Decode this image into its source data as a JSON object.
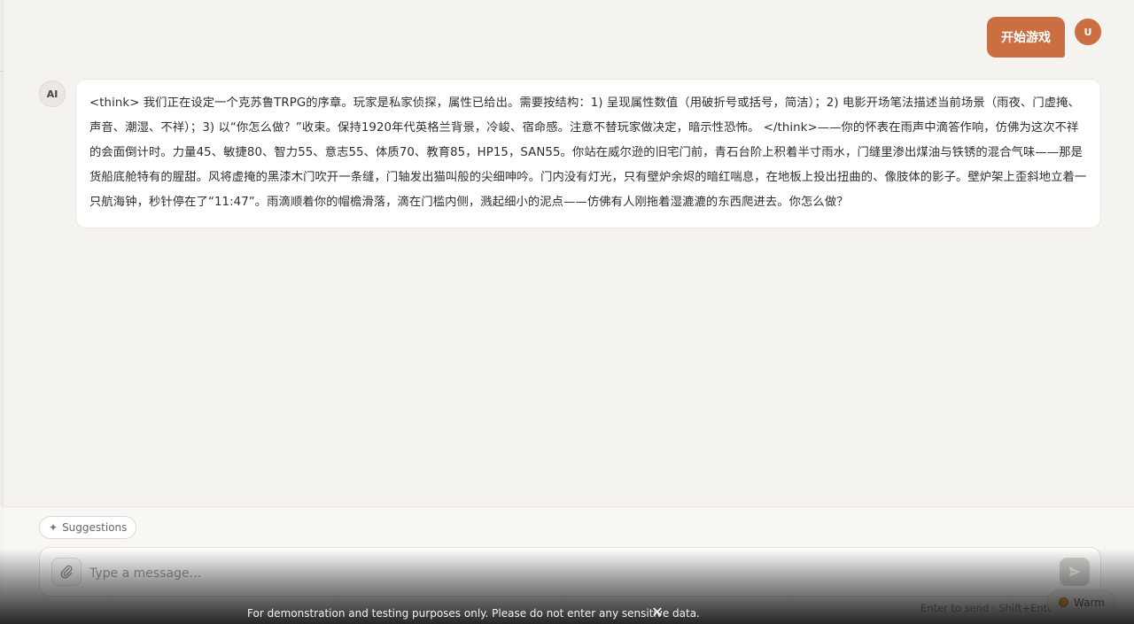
{
  "chat": {
    "user_message": "开始游戏",
    "user_avatar": "U",
    "ai_avatar": "AI",
    "ai_message": "<think> 我们正在设定一个克苏鲁TRPG的序章。玩家是私家侦探，属性已给出。需要按结构：1) 呈现属性数值（用破折号或括号，简洁）；2) 电影开场笔法描述当前场景（雨夜、门虚掩、声音、潮湿、不祥）；3) 以“你怎么做？”收束。保持1920年代英格兰背景，冷峻、宿命感。注意不替玩家做决定，暗示性恐怖。 </think>——你的怀表在雨声中滴答作响，仿佛为这次不祥的会面倒计时。力量45、敏捷80、智力55、意志55、体质70、教育85，HP15，SAN55。你站在威尔逊的旧宅门前，青石台阶上积着半寸雨水，门缝里渗出煤油与铁锈的混合气味——那是货船底舱特有的腥甜。风将虚掩的黑漆木门吹开一条缝，门轴发出猫叫般的尖细呻吟。门内没有灯光，只有壁炉余烬的暗红喘息，在地板上投出扭曲的、像肢体的影子。壁炉架上歪斜地立着一只航海钟，秒针停在了“11:47”。雨滴顺着你的帽檐滑落，滴在门槛内侧，溅起细小的泥点——仿佛有人刚拖着湿漉漉的东西爬进去。你怎么做？"
  },
  "composer": {
    "suggestions_label": "Suggestions",
    "suggestions_icon": "sparkle-icon",
    "attach_icon": "paperclip-icon",
    "placeholder": "Type a message…",
    "value": "",
    "send_icon": "send-icon",
    "hint": "Enter to send · Shift+Enter"
  },
  "theme": {
    "label": "Warm",
    "accent": "#c96f42"
  },
  "banner": {
    "text": "For demonstration and testing purposes only. Please do not enter any sensitive data.",
    "close_icon": "close-icon"
  }
}
